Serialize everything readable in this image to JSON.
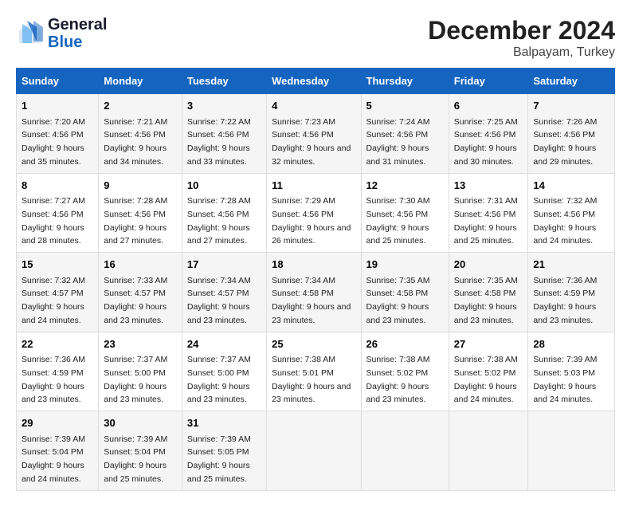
{
  "header": {
    "logo_line1": "General",
    "logo_line2": "Blue",
    "title": "December 2024",
    "subtitle": "Balpayam, Turkey"
  },
  "days_of_week": [
    "Sunday",
    "Monday",
    "Tuesday",
    "Wednesday",
    "Thursday",
    "Friday",
    "Saturday"
  ],
  "weeks": [
    [
      {
        "day": "1",
        "sunrise": "7:20 AM",
        "sunset": "4:56 PM",
        "daylight": "9 hours and 35 minutes."
      },
      {
        "day": "2",
        "sunrise": "7:21 AM",
        "sunset": "4:56 PM",
        "daylight": "9 hours and 34 minutes."
      },
      {
        "day": "3",
        "sunrise": "7:22 AM",
        "sunset": "4:56 PM",
        "daylight": "9 hours and 33 minutes."
      },
      {
        "day": "4",
        "sunrise": "7:23 AM",
        "sunset": "4:56 PM",
        "daylight": "9 hours and 32 minutes."
      },
      {
        "day": "5",
        "sunrise": "7:24 AM",
        "sunset": "4:56 PM",
        "daylight": "9 hours and 31 minutes."
      },
      {
        "day": "6",
        "sunrise": "7:25 AM",
        "sunset": "4:56 PM",
        "daylight": "9 hours and 30 minutes."
      },
      {
        "day": "7",
        "sunrise": "7:26 AM",
        "sunset": "4:56 PM",
        "daylight": "9 hours and 29 minutes."
      }
    ],
    [
      {
        "day": "8",
        "sunrise": "7:27 AM",
        "sunset": "4:56 PM",
        "daylight": "9 hours and 28 minutes."
      },
      {
        "day": "9",
        "sunrise": "7:28 AM",
        "sunset": "4:56 PM",
        "daylight": "9 hours and 27 minutes."
      },
      {
        "day": "10",
        "sunrise": "7:28 AM",
        "sunset": "4:56 PM",
        "daylight": "9 hours and 27 minutes."
      },
      {
        "day": "11",
        "sunrise": "7:29 AM",
        "sunset": "4:56 PM",
        "daylight": "9 hours and 26 minutes."
      },
      {
        "day": "12",
        "sunrise": "7:30 AM",
        "sunset": "4:56 PM",
        "daylight": "9 hours and 25 minutes."
      },
      {
        "day": "13",
        "sunrise": "7:31 AM",
        "sunset": "4:56 PM",
        "daylight": "9 hours and 25 minutes."
      },
      {
        "day": "14",
        "sunrise": "7:32 AM",
        "sunset": "4:56 PM",
        "daylight": "9 hours and 24 minutes."
      }
    ],
    [
      {
        "day": "15",
        "sunrise": "7:32 AM",
        "sunset": "4:57 PM",
        "daylight": "9 hours and 24 minutes."
      },
      {
        "day": "16",
        "sunrise": "7:33 AM",
        "sunset": "4:57 PM",
        "daylight": "9 hours and 23 minutes."
      },
      {
        "day": "17",
        "sunrise": "7:34 AM",
        "sunset": "4:57 PM",
        "daylight": "9 hours and 23 minutes."
      },
      {
        "day": "18",
        "sunrise": "7:34 AM",
        "sunset": "4:58 PM",
        "daylight": "9 hours and 23 minutes."
      },
      {
        "day": "19",
        "sunrise": "7:35 AM",
        "sunset": "4:58 PM",
        "daylight": "9 hours and 23 minutes."
      },
      {
        "day": "20",
        "sunrise": "7:35 AM",
        "sunset": "4:58 PM",
        "daylight": "9 hours and 23 minutes."
      },
      {
        "day": "21",
        "sunrise": "7:36 AM",
        "sunset": "4:59 PM",
        "daylight": "9 hours and 23 minutes."
      }
    ],
    [
      {
        "day": "22",
        "sunrise": "7:36 AM",
        "sunset": "4:59 PM",
        "daylight": "9 hours and 23 minutes."
      },
      {
        "day": "23",
        "sunrise": "7:37 AM",
        "sunset": "5:00 PM",
        "daylight": "9 hours and 23 minutes."
      },
      {
        "day": "24",
        "sunrise": "7:37 AM",
        "sunset": "5:00 PM",
        "daylight": "9 hours and 23 minutes."
      },
      {
        "day": "25",
        "sunrise": "7:38 AM",
        "sunset": "5:01 PM",
        "daylight": "9 hours and 23 minutes."
      },
      {
        "day": "26",
        "sunrise": "7:38 AM",
        "sunset": "5:02 PM",
        "daylight": "9 hours and 23 minutes."
      },
      {
        "day": "27",
        "sunrise": "7:38 AM",
        "sunset": "5:02 PM",
        "daylight": "9 hours and 24 minutes."
      },
      {
        "day": "28",
        "sunrise": "7:39 AM",
        "sunset": "5:03 PM",
        "daylight": "9 hours and 24 minutes."
      }
    ],
    [
      {
        "day": "29",
        "sunrise": "7:39 AM",
        "sunset": "5:04 PM",
        "daylight": "9 hours and 24 minutes."
      },
      {
        "day": "30",
        "sunrise": "7:39 AM",
        "sunset": "5:04 PM",
        "daylight": "9 hours and 25 minutes."
      },
      {
        "day": "31",
        "sunrise": "7:39 AM",
        "sunset": "5:05 PM",
        "daylight": "9 hours and 25 minutes."
      },
      null,
      null,
      null,
      null
    ]
  ],
  "labels": {
    "sunrise": "Sunrise:",
    "sunset": "Sunset:",
    "daylight": "Daylight:"
  }
}
